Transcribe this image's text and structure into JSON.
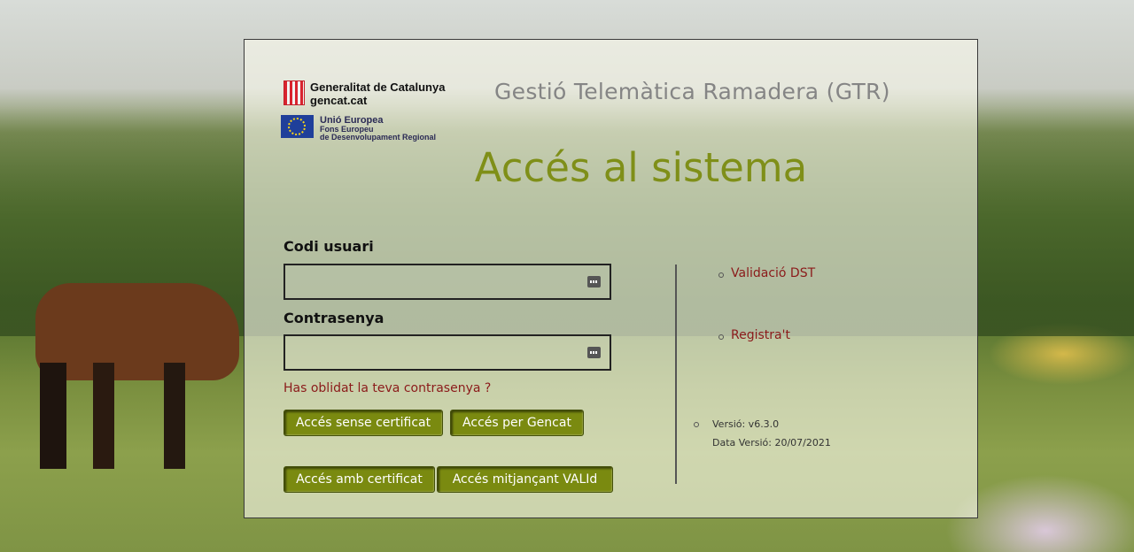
{
  "header": {
    "generalitat_name": "Generalitat de Catalunya",
    "generalitat_site": "gencat.cat",
    "eu_name": "Unió Europea",
    "eu_fund_line1": "Fons Europeu",
    "eu_fund_line2": "de Desenvolupament Regional",
    "app_title": "Gestió Telemàtica Ramadera (GTR)"
  },
  "page_title": "Accés al sistema",
  "login": {
    "user_label": "Codi usuari",
    "user_value": "",
    "password_label": "Contrasenya",
    "password_value": "",
    "forgot_link": "Has oblidat la teva contrasenya ?"
  },
  "buttons": {
    "without_certificate": "Accés sense certificat",
    "via_gencat": "Accés per Gencat",
    "with_certificate": "Accés amb certificat",
    "via_valid": "Accés mitjançant VALId"
  },
  "side_links": {
    "validation": "Validació DST",
    "register": "Registra't"
  },
  "version": {
    "version_text": "Versió: v6.3.0",
    "date_text": "Data Versió: 20/07/2021"
  },
  "colors": {
    "accent": "#7f8f18",
    "button": "#7a8a10",
    "link": "#8b1a1a"
  },
  "icons": [
    "generalitat-logo-icon",
    "eu-flag-icon",
    "password-key-icon",
    "bullet-icon"
  ]
}
